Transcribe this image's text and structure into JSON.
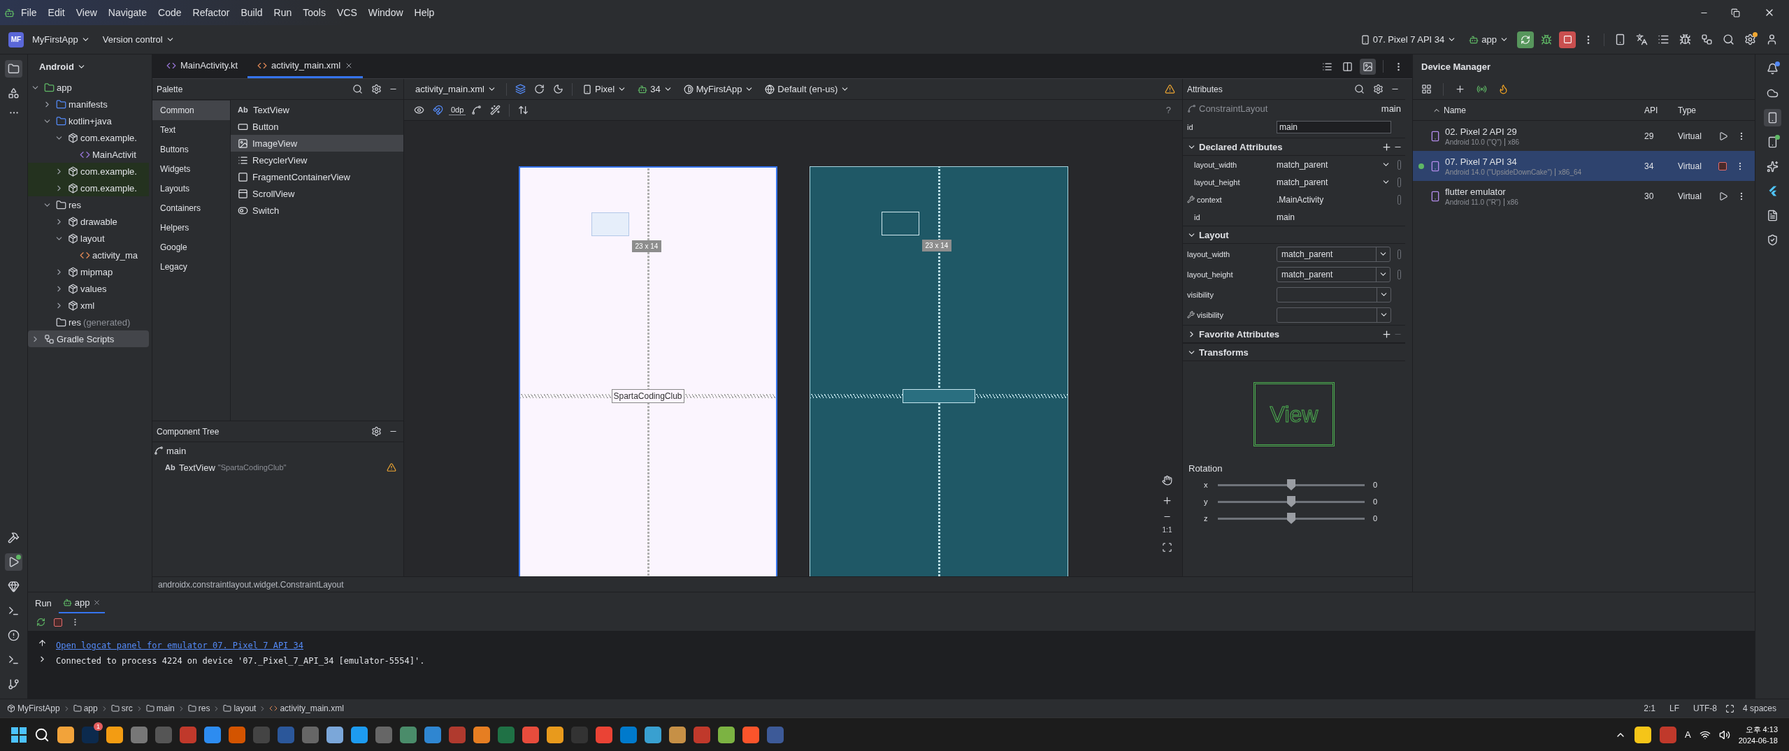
{
  "menu_bar": {
    "items": [
      "File",
      "Edit",
      "View",
      "Navigate",
      "Code",
      "Refactor",
      "Build",
      "Run",
      "Tools",
      "VCS",
      "Window",
      "Help"
    ]
  },
  "toolbar": {
    "project_badge": "MF",
    "project": "MyFirstApp",
    "vcs": "Version control",
    "device": "07. Pixel 7 API 34",
    "run_config": "app"
  },
  "project_panel": {
    "view": "Android",
    "tree": [
      {
        "label": "app",
        "kind": "module",
        "expanded": true,
        "selected": false,
        "children": [
          {
            "label": "manifests",
            "kind": "folder",
            "expanded": false,
            "selected": false
          },
          {
            "label": "kotlin+java",
            "kind": "folder",
            "expanded": true,
            "selected": false,
            "children": [
              {
                "label": "com.example.",
                "kind": "package",
                "expanded": true,
                "selected": false,
                "children": [
                  {
                    "label": "MainActivit",
                    "kind": "class",
                    "selected": false
                  }
                ]
              },
              {
                "label": "com.example.",
                "kind": "package",
                "expanded": false,
                "selected": false,
                "test": true
              },
              {
                "label": "com.example.",
                "kind": "package",
                "expanded": false,
                "selected": false,
                "test": true
              }
            ]
          },
          {
            "label": "res",
            "kind": "resfolder",
            "expanded": true,
            "selected": false,
            "children": [
              {
                "label": "drawable",
                "kind": "package",
                "expanded": false,
                "selected": false
              },
              {
                "label": "layout",
                "kind": "package",
                "expanded": true,
                "selected": false,
                "children": [
                  {
                    "label": "activity_ma",
                    "kind": "xml",
                    "selected": false
                  }
                ]
              },
              {
                "label": "mipmap",
                "kind": "package",
                "expanded": false,
                "selected": false
              },
              {
                "label": "values",
                "kind": "package",
                "expanded": false,
                "selected": false
              },
              {
                "label": "xml",
                "kind": "package",
                "expanded": false,
                "selected": false
              }
            ]
          },
          {
            "label": "res",
            "suffix": "(generated)",
            "kind": "resfolder",
            "selected": false
          }
        ]
      },
      {
        "label": "Gradle Scripts",
        "kind": "gradle",
        "expanded": false,
        "selected": true
      }
    ]
  },
  "editor_tabs": [
    {
      "label": "MainActivity.kt",
      "kind": "kotlin",
      "selected": false
    },
    {
      "label": "activity_main.xml",
      "kind": "xml",
      "selected": true
    }
  ],
  "editor_modes": [
    {
      "kind": "code",
      "selected": false
    },
    {
      "kind": "split",
      "selected": false
    },
    {
      "kind": "design",
      "selected": true
    }
  ],
  "palette": {
    "title": "Palette",
    "categories": [
      {
        "label": "Common",
        "selected": true
      },
      {
        "label": "Text",
        "selected": false
      },
      {
        "label": "Buttons",
        "selected": false
      },
      {
        "label": "Widgets",
        "selected": false
      },
      {
        "label": "Layouts",
        "selected": false
      },
      {
        "label": "Containers",
        "selected": false
      },
      {
        "label": "Helpers",
        "selected": false
      },
      {
        "label": "Google",
        "selected": false
      },
      {
        "label": "Legacy",
        "selected": false
      }
    ],
    "items": [
      {
        "label": "TextView",
        "kind": "text",
        "icon": "Ab",
        "selected": false
      },
      {
        "label": "Button",
        "kind": "button",
        "selected": false
      },
      {
        "label": "ImageView",
        "kind": "image",
        "selected": true
      },
      {
        "label": "RecyclerView",
        "kind": "list",
        "selected": false
      },
      {
        "label": "FragmentContainerView",
        "kind": "frame",
        "selected": false
      },
      {
        "label": "ScrollView",
        "kind": "scroll",
        "selected": false
      },
      {
        "label": "Switch",
        "kind": "switch",
        "selected": false
      }
    ]
  },
  "component_tree": {
    "title": "Component Tree",
    "root": "main",
    "children": [
      {
        "icon": "Ab",
        "label": "TextView",
        "detail": "\"SpartaCodingClub\"",
        "warning": true
      }
    ]
  },
  "design_toolbar": {
    "file": "activity_main.xml",
    "device": "Pixel",
    "api": "34",
    "theme": "MyFirstApp",
    "locale": "Default (en-us)",
    "margin": "0dp",
    "help": "?"
  },
  "canvas": {
    "textview": "SpartaCodingClub",
    "size_label": "23 x 14",
    "blueprint_size_label": "23 x 14",
    "zoom_ratio": "1:1"
  },
  "class_bar": "androidx.constraintlayout.widget.ConstraintLayout",
  "attributes": {
    "title": "Attributes",
    "component": "ConstraintLayout",
    "component_id": "main",
    "id_label": "id",
    "id_value": "main",
    "sections": [
      {
        "title": "Declared Attributes",
        "expanded": true,
        "can_remove": true,
        "rows": [
          {
            "label": "layout_width",
            "value": "match_parent",
            "kind": "inline_dropdown"
          },
          {
            "label": "layout_height",
            "value": "match_parent",
            "kind": "inline_dropdown"
          },
          {
            "label": "context",
            "value": ".MainActivity",
            "kind": "tools_text"
          },
          {
            "label": "id",
            "value": "main",
            "kind": "text"
          }
        ]
      },
      {
        "title": "Layout",
        "expanded": true,
        "rows": [
          {
            "label": "layout_width",
            "value": "match_parent",
            "kind": "dropdown"
          },
          {
            "label": "layout_height",
            "value": "match_parent",
            "kind": "dropdown"
          },
          {
            "label": "visibility",
            "kind": "dropdown"
          },
          {
            "label": "visibility",
            "kind": "tools_dropdown"
          }
        ]
      },
      {
        "title": "Favorite Attributes",
        "expanded": false,
        "can_remove": false
      },
      {
        "title": "Transforms",
        "expanded": true,
        "kind": "transforms"
      }
    ],
    "preview": "View",
    "rotation": {
      "title": "Rotation",
      "axes": [
        {
          "label": "x",
          "level": 0.5,
          "reading": "0"
        },
        {
          "label": "y",
          "level": 0.5,
          "reading": "0"
        },
        {
          "label": "z",
          "level": 0.5,
          "reading": "0"
        }
      ]
    }
  },
  "device_manager": {
    "title": "Device Manager",
    "columns": [
      "Name",
      "API",
      "Type"
    ],
    "devices": [
      {
        "name": "02. Pixel 2 API 29",
        "detail": [
          "Android 10.0 (\"Q\")",
          "x86"
        ],
        "api": "29",
        "type": "Virtual",
        "running": false,
        "selected": false
      },
      {
        "name": "07. Pixel 7 API 34",
        "detail": [
          "Android 14.0 (\"UpsideDownCake\")",
          "x86_64"
        ],
        "api": "34",
        "type": "Virtual",
        "running": true,
        "selected": true
      },
      {
        "name": "flutter emulator",
        "detail": [
          "Android 11.0 (\"R\")",
          "x86"
        ],
        "api": "30",
        "type": "Virtual",
        "running": false,
        "selected": false
      }
    ]
  },
  "run_panel": {
    "title": "Run",
    "tabs": [
      {
        "label": "app",
        "selected": true
      }
    ],
    "link": "Open logcat panel for emulator 07. Pixel 7 API 34",
    "lines": [
      "Connected to process 4224 on device '07._Pixel_7_API_34 [emulator-5554]'."
    ]
  },
  "status_bar": {
    "breadcrumb": [
      {
        "label": "MyFirstApp",
        "kind": "project"
      },
      {
        "label": "app",
        "kind": "module"
      },
      {
        "label": "src",
        "kind": "folder"
      },
      {
        "label": "main",
        "kind": "folder"
      },
      {
        "label": "res",
        "kind": "folder"
      },
      {
        "label": "layout",
        "kind": "folder"
      },
      {
        "label": "activity_main.xml",
        "kind": "xml"
      }
    ],
    "position": "2:1",
    "line_ending": "LF",
    "encoding": "UTF-8",
    "indent": "4 spaces"
  },
  "taskbar": {
    "badge": "1",
    "ime": "A",
    "time": "오후 4:13",
    "date": "2024-06-18"
  }
}
